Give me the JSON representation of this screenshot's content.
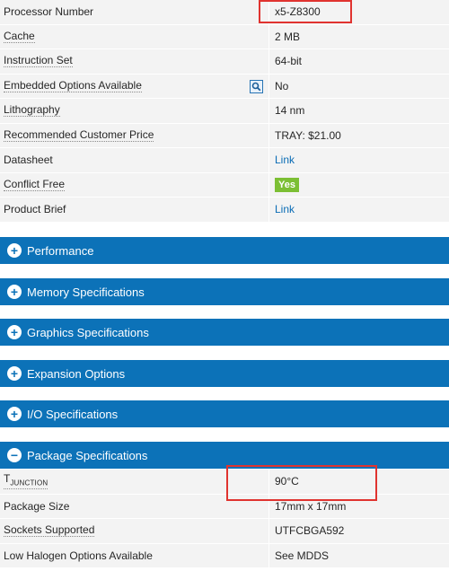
{
  "essentials": [
    {
      "label": "Processor Number",
      "value": "x5-Z8300",
      "underline": false,
      "value_type": "text"
    },
    {
      "label": "Cache",
      "value": "2 MB",
      "underline": true,
      "value_type": "text"
    },
    {
      "label": "Instruction Set",
      "value": "64-bit",
      "underline": true,
      "value_type": "text"
    },
    {
      "label": "Embedded Options Available",
      "value": "No",
      "underline": true,
      "value_type": "text"
    },
    {
      "label": "Lithography",
      "value": "14 nm",
      "underline": true,
      "value_type": "text"
    },
    {
      "label": "Recommended Customer Price",
      "value": "TRAY: $21.00",
      "underline": true,
      "value_type": "text"
    },
    {
      "label": "Datasheet",
      "value": "Link",
      "underline": false,
      "value_type": "link"
    },
    {
      "label": "Conflict Free",
      "value": "Yes",
      "underline": true,
      "value_type": "badge"
    },
    {
      "label": "Product Brief",
      "value": "Link",
      "underline": false,
      "value_type": "link"
    }
  ],
  "sections": [
    {
      "label": "Performance",
      "icon": "plus"
    },
    {
      "label": "Memory Specifications",
      "icon": "plus"
    },
    {
      "label": "Graphics Specifications",
      "icon": "plus"
    },
    {
      "label": "Expansion Options",
      "icon": "plus"
    },
    {
      "label": "I/O Specifications",
      "icon": "plus"
    },
    {
      "label": "Package Specifications",
      "icon": "minus"
    }
  ],
  "package": {
    "tjunction": {
      "main": "T",
      "sub": "JUNCTION",
      "value": "90°C"
    },
    "rows": [
      {
        "label": "Package Size",
        "value": "17mm x 17mm",
        "underline": false
      },
      {
        "label": "Sockets Supported",
        "value": "UTFCBGA592",
        "underline": true
      },
      {
        "label": "Low Halogen Options Available",
        "value": "See MDDS",
        "underline": false
      }
    ]
  },
  "colors": {
    "section_bg": "#0c72b8",
    "row_bg": "#f3f3f3",
    "link": "#0a6cb5",
    "badge_green": "#7cbf34",
    "highlight_red": "#e0332f"
  }
}
